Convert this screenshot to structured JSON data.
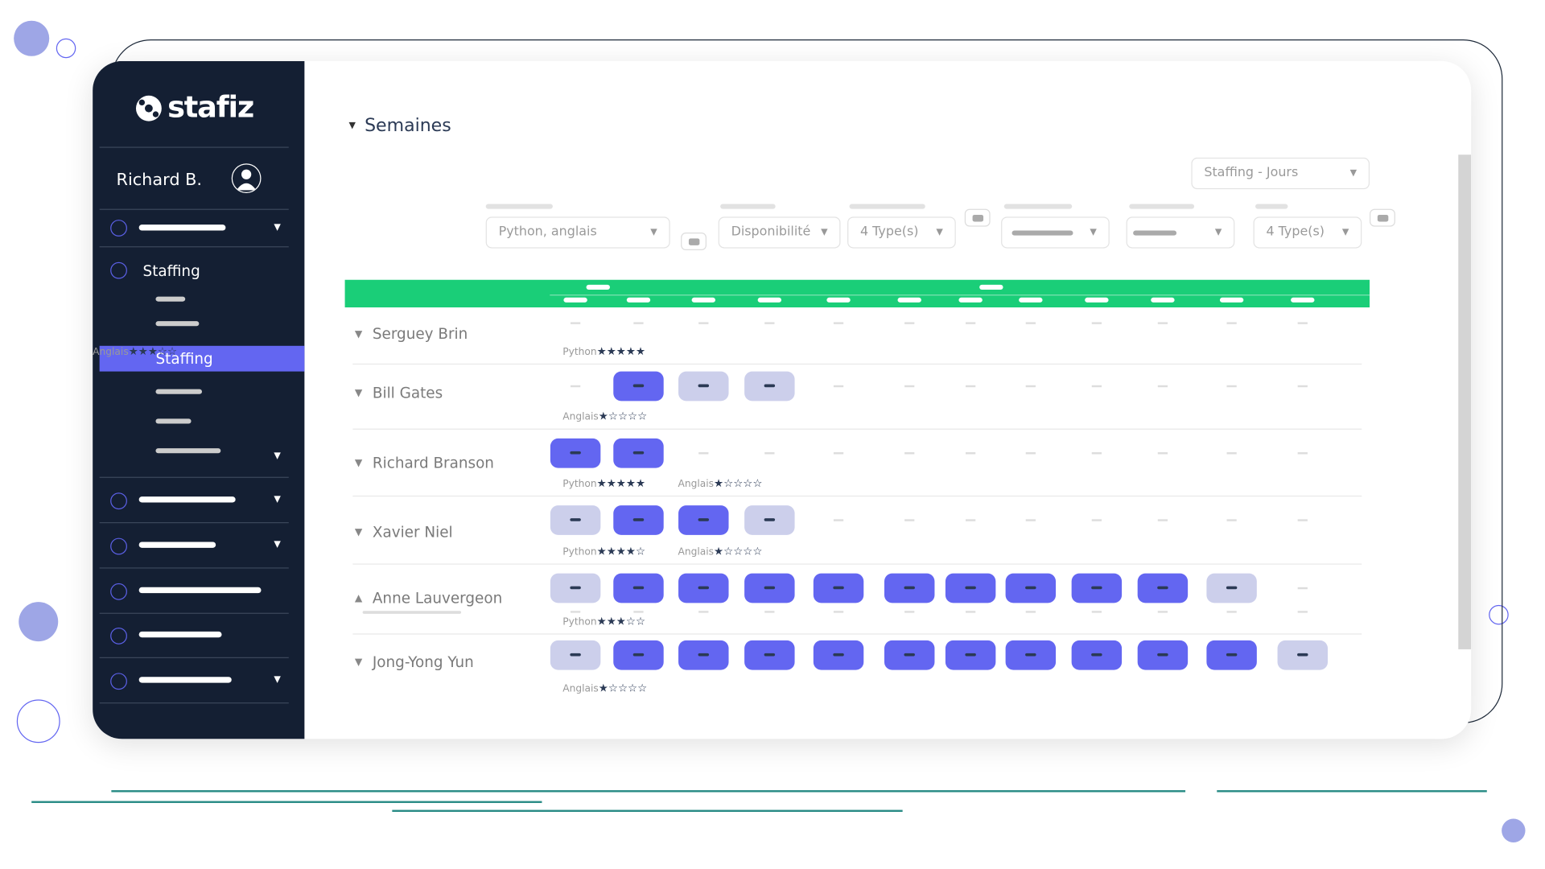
{
  "brand": "stafiz",
  "user": {
    "name": "Richard B."
  },
  "sidebar": {
    "section": "Staffing",
    "active": "Staffing"
  },
  "section_title": "Semaines",
  "view_select": "Staffing - Jours",
  "filters": {
    "skills": "Python, anglais",
    "availability": "Disponibilité",
    "types_1": "4 Type(s)",
    "types_2": "4 Type(s)"
  },
  "colors": {
    "accent": "#6366f1",
    "light": "#cccfeb",
    "header": "#1ace78",
    "sidebar": "#141f33"
  },
  "rows": [
    {
      "name": "Serguey Brin",
      "expanded": false,
      "cells": [
        0,
        0,
        0,
        0,
        0,
        0,
        0,
        0,
        0,
        0,
        0,
        0
      ],
      "skills": [
        {
          "label": "Python",
          "stars": 5
        },
        {
          "label": "Anglais",
          "stars": 3
        }
      ]
    },
    {
      "name": "Bill Gates",
      "expanded": false,
      "cells": [
        0,
        1,
        2,
        2,
        0,
        0,
        0,
        0,
        0,
        0,
        0,
        0
      ],
      "skills": [
        {
          "label": "Anglais",
          "stars": 1
        }
      ]
    },
    {
      "name": "Richard Branson",
      "expanded": false,
      "cells": [
        1,
        1,
        0,
        0,
        0,
        0,
        0,
        0,
        0,
        0,
        0,
        0
      ],
      "skills": [
        {
          "label": "Python",
          "stars": 5
        },
        {
          "label": "Anglais",
          "stars": 1
        }
      ]
    },
    {
      "name": "Xavier Niel",
      "expanded": false,
      "cells": [
        2,
        1,
        1,
        2,
        0,
        0,
        0,
        0,
        0,
        0,
        0,
        0
      ],
      "skills": [
        {
          "label": "Python",
          "stars": 4
        },
        {
          "label": "Anglais",
          "stars": 1
        }
      ]
    },
    {
      "name": "Anne Lauvergeon",
      "expanded": true,
      "cells": [
        2,
        1,
        1,
        1,
        1,
        1,
        1,
        1,
        1,
        1,
        2,
        0
      ],
      "skills": [
        {
          "label": "Python",
          "stars": 3
        }
      ]
    },
    {
      "name": "Jong-Yong Yun",
      "expanded": false,
      "cells": [
        2,
        1,
        1,
        1,
        1,
        1,
        1,
        1,
        1,
        1,
        1,
        2
      ],
      "skills": [
        {
          "label": "Anglais",
          "stars": 1
        }
      ]
    }
  ]
}
